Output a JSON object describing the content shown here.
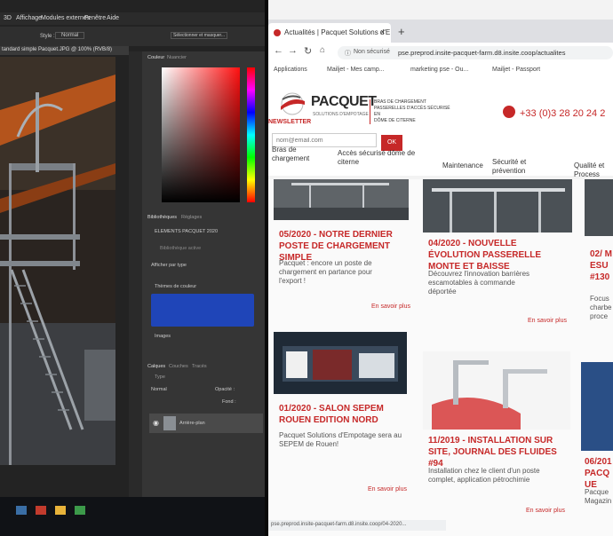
{
  "photoshop": {
    "menus": [
      "3D",
      "Affichage",
      "Modules externes",
      "Fenêtre",
      "Aide"
    ],
    "options": {
      "style_label": "Style :",
      "style_value": "Normal",
      "select_button": "Sélectionner et masquer..."
    },
    "document_tab": "tandard simple Pacquet.JPG @ 100% (RVB/8)",
    "color_panel": {
      "tab_couleur": "Couleur",
      "tab_nuancier": "Nuancier"
    },
    "libraries_panel": {
      "tab_bibliotheques": "Bibliothèques",
      "tab_reglages": "Réglages",
      "library_name": "ELEMENTS PACQUET 2020",
      "search_placeholder": "Bibliothèque active",
      "display_by": "Afficher par type",
      "section_colors": "Thèmes de couleur",
      "section_images": "Images"
    },
    "layers_panel": {
      "tab_calques": "Calques",
      "tab_couches": "Couches",
      "tab_traces": "Tracés",
      "kind_filter": "Type",
      "blend_mode": "Normal",
      "opacity_label": "Opacité :",
      "fill_label": "Fond :",
      "layer_name": "Arrière-plan"
    }
  },
  "browser": {
    "tab_title": "Actualités | Pacquet Solutions d'E",
    "address": {
      "security": "Non sécurisé",
      "url": "pse.preprod.insite-pacquet-farm.d8.insite.coop/actualites"
    },
    "bookmarks": [
      "Applications",
      "Mailjet - Mes camp...",
      "marketing pse - Ou...",
      "Mailjet - Passport"
    ],
    "status_url": "pse.preprod.insite-pacquet-farm.d8.insite.coop/04-2020...",
    "site": {
      "brand": "PACQUET",
      "brand_sub": "SOLUTIONS D'EMPOTAGE",
      "taglines": [
        "BRAS DE CHARGEMENT",
        "PASSERELLES D'ACCÈS SÉCURISÉ EN",
        "DÔME DE CITERNE"
      ],
      "phone": "+33 (0)3 28 20 24 2",
      "newsletter": "NEWSLETTER",
      "email_placeholder": "nom@email.com",
      "ok": "OK",
      "nav": [
        "Bras de chargement",
        "Accès sécurisé dôme de citerne",
        "Maintenance",
        "Sécurité et prévention",
        "Qualité et Process"
      ],
      "cards": [
        {
          "title": "05/2020 - NOTRE DERNIER POSTE DE CHARGEMENT SIMPLE",
          "text": "Pacquet : encore un poste de chargement en partance pour l'export !",
          "more": "En savoir plus"
        },
        {
          "title": "04/2020 - NOUVELLE ÉVOLUTION PASSERELLE MONTE ET BAISSE",
          "text": "Découvrez l'innovation barrières escamotables à commande déportée",
          "more": "En savoir plus"
        },
        {
          "title": "02/ MESU #130",
          "text": "Focus charbe proce",
          "more": ""
        },
        {
          "title": "01/2020 - SALON SEPEM ROUEN EDITION NORD",
          "text": "Pacquet Solutions d'Empotage sera au SEPEM de Rouen!",
          "more": "En savoir plus"
        },
        {
          "title": "11/2019 - INSTALLATION SUR SITE, JOURNAL DES FLUIDES #94",
          "text": "Installation chez le client d'un poste complet, application pétrochimie",
          "more": "En savoir plus"
        },
        {
          "title": "06/201 PACQUE",
          "text": "Pacque Magazin",
          "more": ""
        }
      ]
    }
  },
  "colors": {
    "brand_red": "#c62828",
    "swatch_blue": "#1f45b8"
  }
}
